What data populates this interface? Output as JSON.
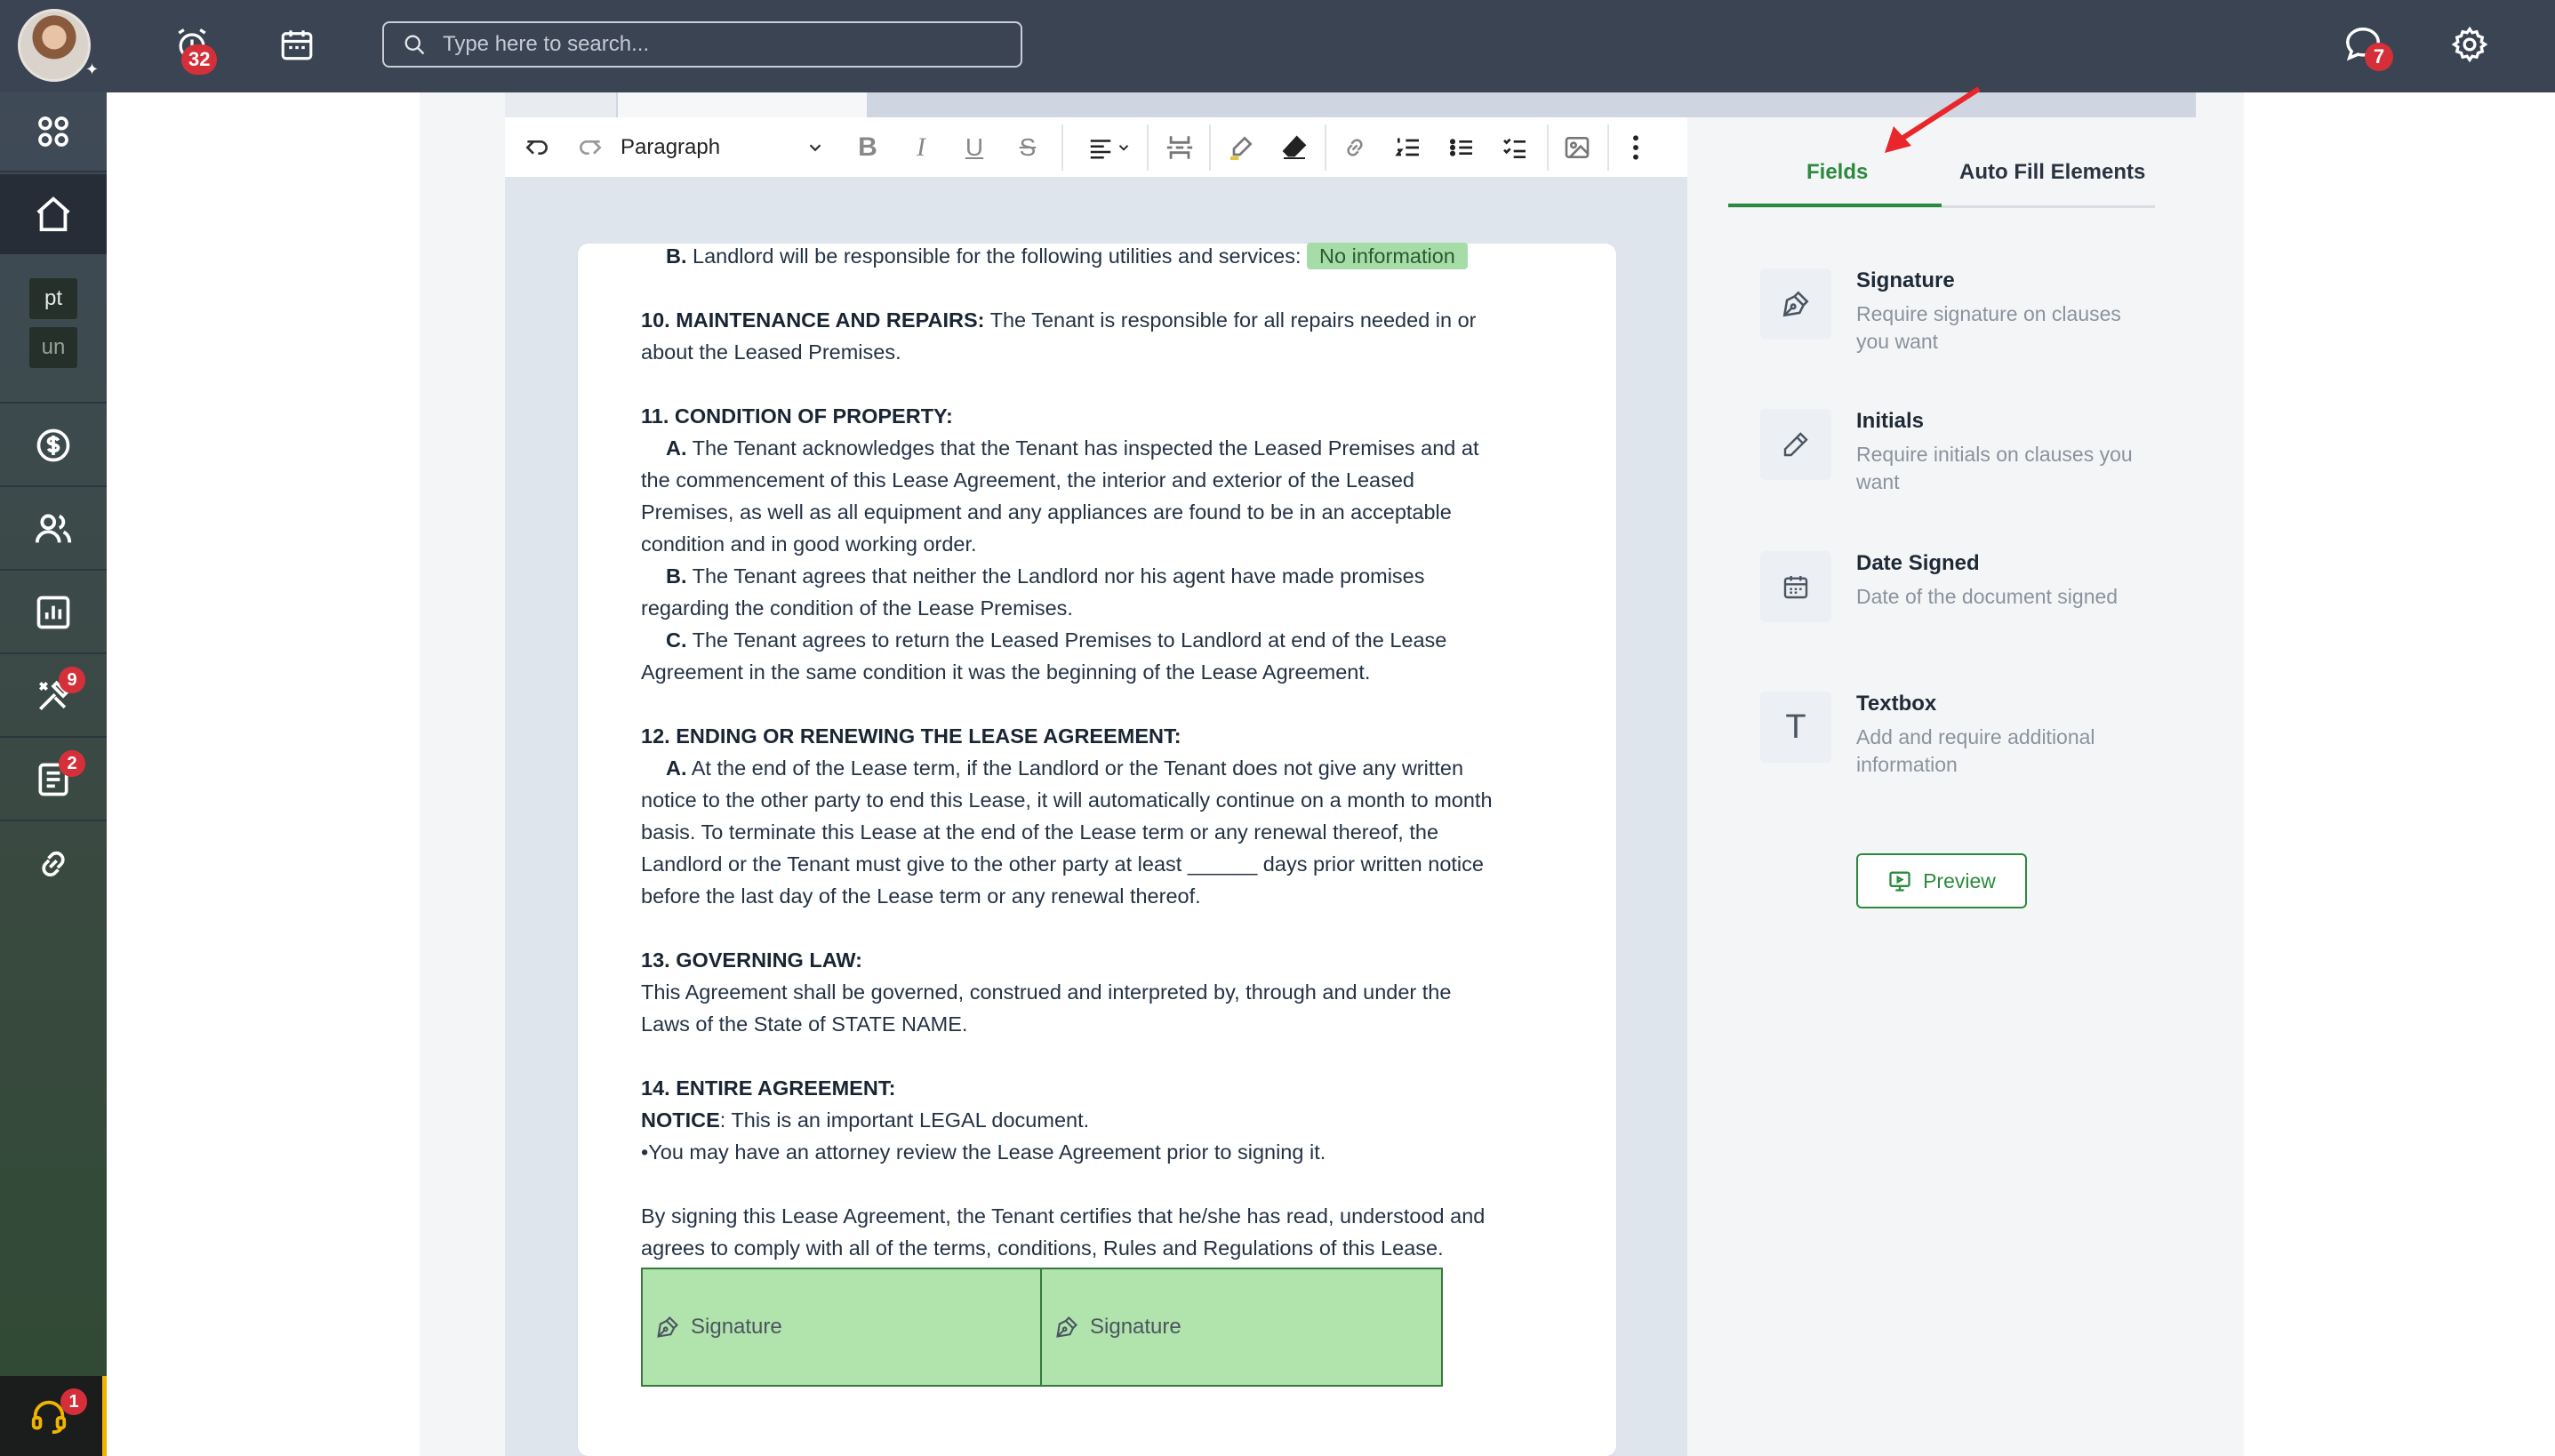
{
  "topbar": {
    "reminders_badge": "32",
    "search_placeholder": "Type here to search...",
    "messages_badge": "7"
  },
  "sidebar": {
    "tags": [
      "pt",
      "un"
    ],
    "tools_badge": "9",
    "docs_badge": "2",
    "support_badge": "1"
  },
  "toolbar": {
    "paragraph_style": "Paragraph"
  },
  "document": {
    "line_b_utilities": "Landlord will be responsible for the following utilities and services:",
    "b_label": "B.",
    "no_information": "No information",
    "s10_heading": "10. MAINTENANCE AND REPAIRS:",
    "s10_text": " The Tenant is responsible for all repairs needed in or",
    "s10_text2": "about the Leased Premises.",
    "s11_heading": "11. CONDITION OF PROPERTY:",
    "s11_a_label": "A.",
    "s11_a1": " The Tenant acknowledges that the Tenant has inspected the Leased Premises and at",
    "s11_a2": "the commencement of this Lease Agreement, the interior and exterior of the Leased",
    "s11_a3": "Premises, as well as all equipment and any appliances are found to be in an acceptable",
    "s11_a4": "condition and in good working order.",
    "s11_b_label": "B.",
    "s11_b1": " The Tenant agrees that neither the Landlord nor his agent have made promises",
    "s11_b2": "regarding the condition of the Lease Premises.",
    "s11_c_label": "C.",
    "s11_c1": " The Tenant agrees to return the Leased Premises to Landlord at end of the Lease",
    "s11_c2": "Agreement in the same condition it was the beginning of the Lease Agreement.",
    "s12_heading": "12. ENDING OR RENEWING THE LEASE AGREEMENT:",
    "s12_a_label": "A.",
    "s12_a1": " At the end of the Lease term, if the Landlord or the Tenant does not give any written",
    "s12_a2": "notice to the other party to end this Lease, it will automatically continue on a month to month",
    "s12_a3": "basis. To terminate this Lease at the end of the Lease term or any renewal thereof, the",
    "s12_a4": "Landlord or the Tenant must give to the other party at least ______ days prior written notice",
    "s12_a5": "before the last day of the Lease term or any renewal thereof.",
    "s13_heading": "13. GOVERNING LAW:",
    "s13_1": "This Agreement shall be governed, construed and interpreted by, through and under the",
    "s13_2": "Laws of the State of STATE NAME.",
    "s14_heading": "14. ENTIRE AGREEMENT:",
    "notice_label": "NOTICE",
    "notice_text": ": This is an important LEGAL document.",
    "bullet": "•You may have an attorney review the Lease Agreement prior to signing it.",
    "closing1": "By signing this Lease Agreement, the Tenant certifies that he/she has read, understood and",
    "closing2": "agrees to comply with all of the terms, conditions, Rules and Regulations of this Lease.",
    "signature_boxes": [
      "Signature",
      "Signature"
    ]
  },
  "right_panel": {
    "tabs": [
      "Fields",
      "Auto Fill Elements"
    ],
    "fields": [
      {
        "title": "Signature",
        "desc": "Require signature on clauses you want",
        "icon": "pen-nib-icon"
      },
      {
        "title": "Initials",
        "desc": "Require initials on clauses you want",
        "icon": "pencil-icon"
      },
      {
        "title": "Date Signed",
        "desc": "Date of the document signed",
        "icon": "calendar-icon"
      },
      {
        "title": "Textbox",
        "desc": "Add and require additional information",
        "icon": "text-t-icon"
      }
    ],
    "textbox_glyph": "T",
    "preview_label": "Preview"
  },
  "colors": {
    "topbar": "#3a4453",
    "accent_green": "#2b8a3e",
    "signature_fill": "#b1e3ad",
    "badge_red": "#d5303a",
    "annotation_arrow": "#e8262b"
  }
}
